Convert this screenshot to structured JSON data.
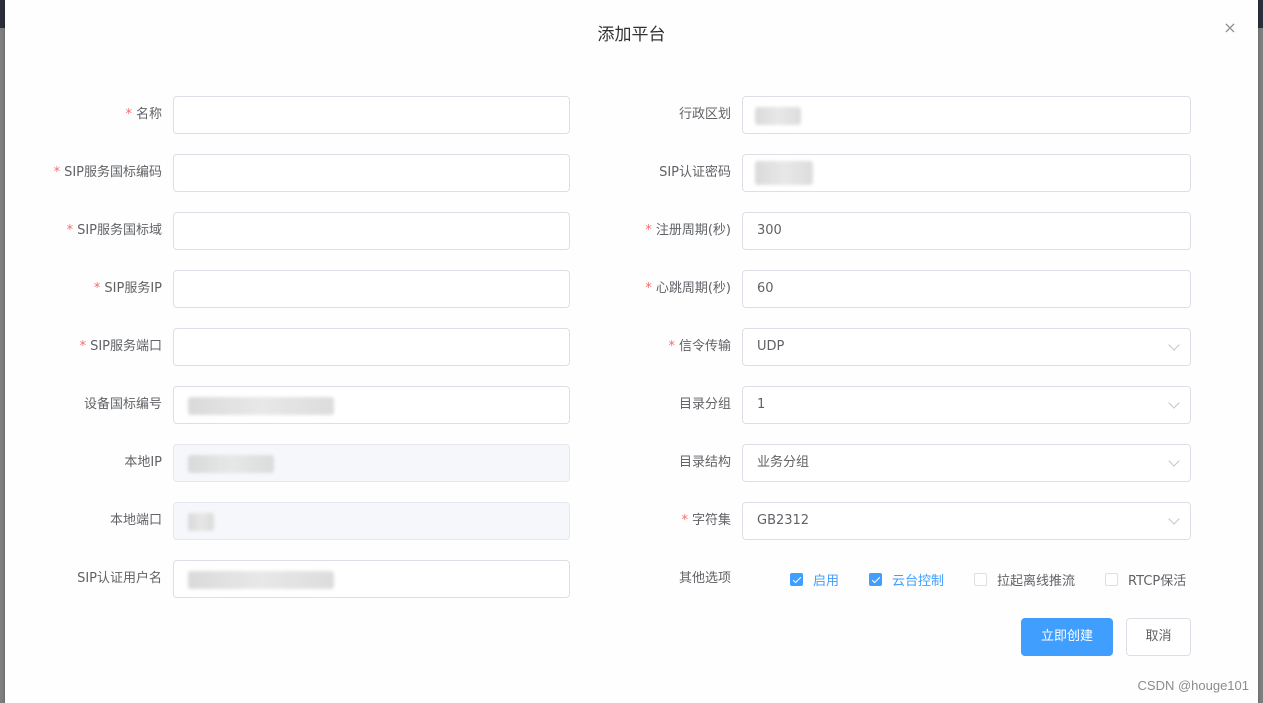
{
  "dialog": {
    "title": "添加平台",
    "close_icon": "×"
  },
  "left_fields": [
    {
      "label": "名称",
      "required": true,
      "value": ""
    },
    {
      "label": "SIP服务国标编码",
      "required": true,
      "value": ""
    },
    {
      "label": "SIP服务国标域",
      "required": true,
      "value": ""
    },
    {
      "label": "SIP服务IP",
      "required": true,
      "value": ""
    },
    {
      "label": "SIP服务端口",
      "required": true,
      "value": ""
    },
    {
      "label": "设备国标编号",
      "required": false,
      "value": ""
    },
    {
      "label": "本地IP",
      "required": false,
      "value": "",
      "disabled": true
    },
    {
      "label": "本地端口",
      "required": false,
      "value": "",
      "disabled": true
    },
    {
      "label": "SIP认证用户名",
      "required": false,
      "value": ""
    }
  ],
  "right_fields": [
    {
      "label": "行政区划",
      "required": false,
      "value": ""
    },
    {
      "label": "SIP认证密码",
      "required": false,
      "value": ""
    },
    {
      "label": "注册周期(秒)",
      "required": true,
      "value": "300"
    },
    {
      "label": "心跳周期(秒)",
      "required": true,
      "value": "60"
    },
    {
      "label": "信令传输",
      "required": true,
      "value": "UDP",
      "type": "select"
    },
    {
      "label": "目录分组",
      "required": false,
      "value": "1",
      "type": "select"
    },
    {
      "label": "目录结构",
      "required": false,
      "value": "业务分组",
      "type": "select"
    },
    {
      "label": "字符集",
      "required": true,
      "value": "GB2312",
      "type": "select"
    }
  ],
  "other_options": {
    "label": "其他选项",
    "items": [
      {
        "label": "启用",
        "checked": true
      },
      {
        "label": "云台控制",
        "checked": true
      },
      {
        "label": "拉起离线推流",
        "checked": false
      },
      {
        "label": "RTCP保活",
        "checked": false
      }
    ]
  },
  "buttons": {
    "create": "立即创建",
    "cancel": "取消"
  },
  "required_mark": "*",
  "watermark": "CSDN @houge101",
  "colors": {
    "primary": "#409eff",
    "required": "#f56c6c",
    "overlay": "#7f7f7f"
  }
}
